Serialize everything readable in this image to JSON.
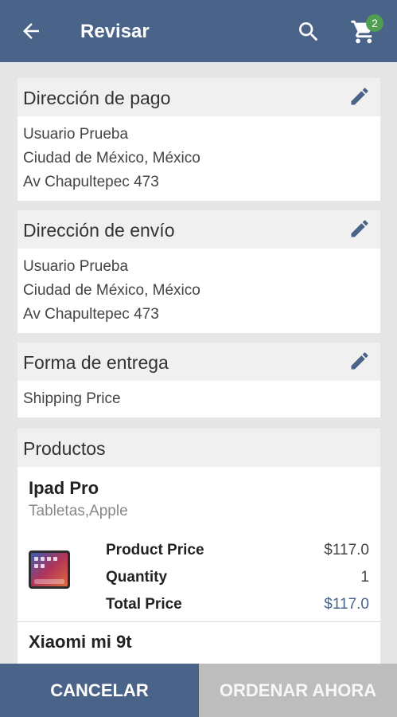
{
  "appbar": {
    "title": "Revisar",
    "cart_count": "2"
  },
  "payment": {
    "heading": "Dirección de pago",
    "lines": [
      "Usuario Prueba",
      "Ciudad de México, México",
      "Av Chapultepec 473"
    ]
  },
  "shipping": {
    "heading": "Dirección de envío",
    "lines": [
      "Usuario Prueba",
      "Ciudad de México, México",
      "Av Chapultepec 473"
    ]
  },
  "delivery": {
    "heading": "Forma de entrega",
    "value": "Shipping Price"
  },
  "products": {
    "heading": "Productos",
    "items": [
      {
        "name": "Ipad Pro",
        "category": "Tabletas,Apple",
        "price_label": "Product Price",
        "price": "$117.0",
        "qty_label": "Quantity",
        "qty": "1",
        "total_label": "Total Price",
        "total": "$117.0"
      },
      {
        "name": "Xiaomi mi 9t"
      }
    ]
  },
  "actions": {
    "cancel": "CANCELAR",
    "order": "ORDENAR AHORA"
  },
  "colors": {
    "primary": "#4a6389",
    "badge": "#4f9e52",
    "disabled": "#bdbdbd"
  }
}
